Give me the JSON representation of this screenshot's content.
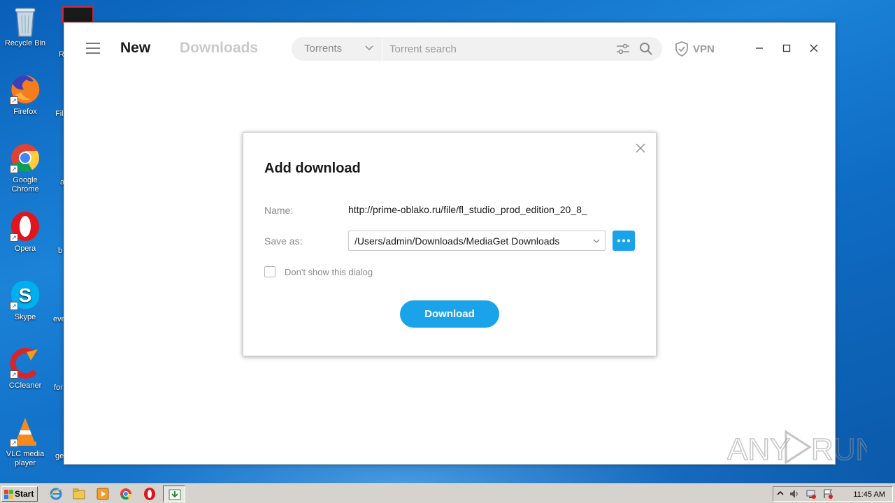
{
  "desktop": {
    "icons": [
      {
        "label": "Recycle Bin",
        "icon": "recycle-bin-icon"
      },
      {
        "label": "Firefox",
        "icon": "firefox-icon"
      },
      {
        "label": "Google Chrome",
        "icon": "chrome-icon"
      },
      {
        "label": "Opera",
        "icon": "opera-icon"
      },
      {
        "label": "Skype",
        "icon": "skype-icon"
      },
      {
        "label": "CCleaner",
        "icon": "ccleaner-icon"
      },
      {
        "label": "VLC media player",
        "icon": "vlc-icon"
      }
    ],
    "partial_labels": [
      "R",
      "Fil",
      "a",
      "b",
      "eve",
      "for",
      "ge"
    ]
  },
  "app": {
    "tabs": {
      "new": "New",
      "downloads": "Downloads"
    },
    "search": {
      "type_label": "Torrents",
      "placeholder": "Torrent search"
    },
    "vpn_label": "VPN",
    "accent_color": "#1aa3e8"
  },
  "dialog": {
    "title": "Add download",
    "name_label": "Name:",
    "name_value": "http://prime-oblako.ru/file/fl_studio_prod_edition_20_8_",
    "save_as_label": "Save as:",
    "save_as_value": "/Users/admin/Downloads/MediaGet Downloads",
    "checkbox_label": "Don't show this dialog",
    "checkbox_checked": false,
    "download_button": "Download"
  },
  "taskbar": {
    "start_label": "Start",
    "clock": "11:45 AM"
  },
  "watermark": "ANY RUN"
}
